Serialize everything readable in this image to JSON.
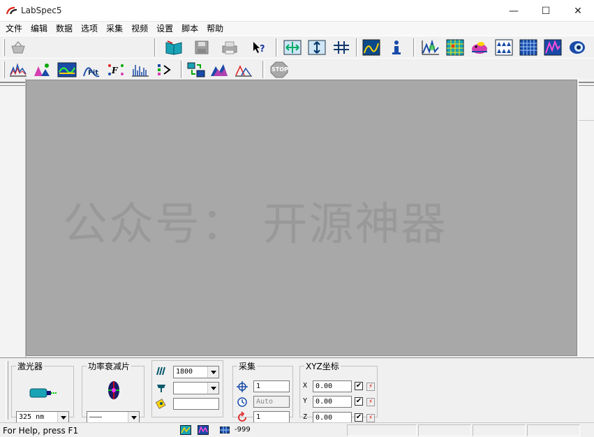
{
  "window": {
    "title": "LabSpec5",
    "minimize_glyph": "—",
    "maximize_glyph": "☐",
    "close_glyph": "✕"
  },
  "menu": [
    "文件",
    "编辑",
    "数据",
    "选项",
    "采集",
    "视频",
    "设置",
    "脚本",
    "帮助"
  ],
  "toolbar1_icons": [
    "basket-icon",
    "open-book-icon",
    "save-disk-icon",
    "print-icon",
    "whats-this-help-icon",
    "fit-arrows-icon",
    "vertical-arrows-icon",
    "cross-cursor-icon",
    "spectrum-map-icon",
    "info-icon",
    "peak-fit-icon",
    "grid-map-icon",
    "pig-icon",
    "triangles-grid-icon",
    "blue-grid-icon",
    "spectrum-bars-icon",
    "camera-lens-icon"
  ],
  "toolbar2_icons": [
    "spectrum-icon",
    "peaks-icon",
    "baseline-icon",
    "fit-icon",
    "fx-icon",
    "multi-peak-icon",
    "export-icon",
    "data-transfer-icon",
    "3d-plot-icon",
    "overlay-icon",
    "stop-icon"
  ],
  "stop_label": "STOP",
  "watermark": "公众号： 开源神器",
  "panels": {
    "laser": {
      "legend": "激光器",
      "value": "325  nm"
    },
    "filter": {
      "legend": "功率衰减片",
      "value": "———"
    },
    "grating": {
      "value": "1800",
      "combo2": "",
      "field3": ""
    },
    "acquisition": {
      "legend": "采集",
      "count": "1",
      "time": "Auto",
      "accum": "1"
    },
    "xyz": {
      "legend": "XYZ坐标",
      "rows": [
        {
          "axis": "X",
          "value": "0.00",
          "checked": "✔",
          "go": "⚡"
        },
        {
          "axis": "Y",
          "value": "0.00",
          "checked": "✔",
          "go": "⚡"
        },
        {
          "axis": "Z",
          "value": "0.00",
          "checked": "✔",
          "go": "⚡"
        }
      ]
    }
  },
  "status": {
    "help": "For Help, press F1",
    "value": "-999"
  },
  "colors": {
    "canvas": "#a8a8a8",
    "accent_blue": "#1e6ad6",
    "accent_teal": "#0aa0a0"
  }
}
